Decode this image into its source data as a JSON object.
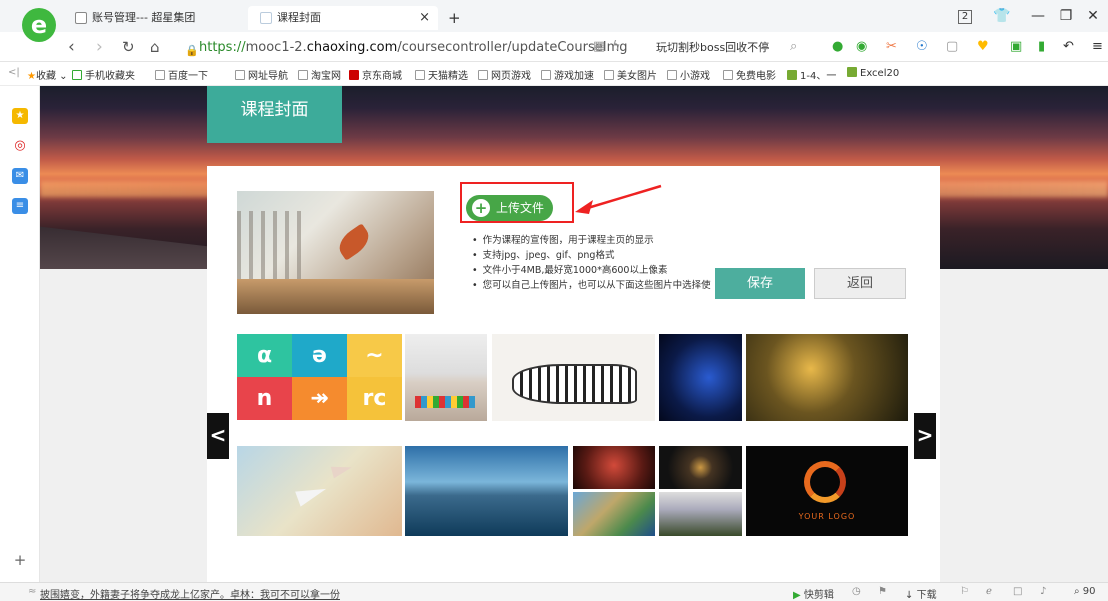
{
  "browser": {
    "tabs": [
      {
        "title": "账号管理--- 超星集团"
      },
      {
        "title": "课程封面"
      }
    ],
    "new_tab_symbol": "+",
    "close_tab_symbol": "×",
    "tab_count": "2",
    "url": {
      "scheme": "https://",
      "pre": "mooc1-2.",
      "domain": "chaoxing.com",
      "path": "/coursecontroller/updateCourseImg"
    },
    "search_hint": "玩切割秒boss回收不停",
    "bookmarks": [
      "收藏",
      "手机收藏夹",
      "百度一下",
      "网址导航",
      "淘宝网",
      "京东商城",
      "天猫精选",
      "网页游戏",
      "游戏加速",
      "美女图片",
      "小游戏",
      "免费电影",
      "1-4、一",
      "Excel20"
    ]
  },
  "page": {
    "title": "课程封面",
    "upload_label": "上传文件",
    "tips": [
      "作为课程的宣传图，用于课程主页的显示",
      "支持jpg、jpeg、gif、png格式",
      "文件小于4MB,最好宽1000*高600以上像素",
      "您可以自己上传图片，也可以从下面这些图片中选择使"
    ],
    "save_label": "保存",
    "back_label": "返回",
    "prev_symbol": "<",
    "next_symbol": ">",
    "logo_text": "YOUR LOGO"
  },
  "status": {
    "news": "披围嬉变，外籍妻子将争夺成龙上亿家产。卓林：我可不可以拿一份",
    "clip_label": "快剪辑",
    "download_label": "下载",
    "zoom": "90"
  },
  "colors": {
    "accent": "#3dab9a",
    "upload": "#47a647",
    "highlight": "#e22222"
  }
}
